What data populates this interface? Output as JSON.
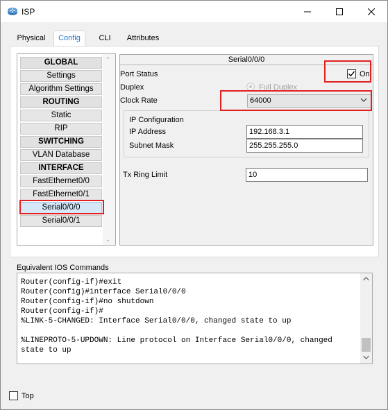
{
  "window": {
    "title": "ISP"
  },
  "tabs": [
    {
      "label": "Physical",
      "active": false
    },
    {
      "label": "Config",
      "active": true
    },
    {
      "label": "CLI",
      "active": false
    },
    {
      "label": "Attributes",
      "active": false
    }
  ],
  "sidebar": {
    "items": [
      {
        "label": "GLOBAL",
        "type": "header"
      },
      {
        "label": "Settings",
        "type": "item"
      },
      {
        "label": "Algorithm Settings",
        "type": "item"
      },
      {
        "label": "ROUTING",
        "type": "header"
      },
      {
        "label": "Static",
        "type": "item"
      },
      {
        "label": "RIP",
        "type": "item"
      },
      {
        "label": "SWITCHING",
        "type": "header"
      },
      {
        "label": "VLAN Database",
        "type": "item"
      },
      {
        "label": "INTERFACE",
        "type": "header"
      },
      {
        "label": "FastEthernet0/0",
        "type": "item"
      },
      {
        "label": "FastEthernet0/1",
        "type": "item"
      },
      {
        "label": "Serial0/0/0",
        "type": "item",
        "selected": true
      },
      {
        "label": "Serial0/0/1",
        "type": "item"
      }
    ]
  },
  "interface": {
    "title": "Serial0/0/0",
    "port_status_label": "Port Status",
    "port_status_checkbox_label": "On",
    "port_status_on": true,
    "duplex_label": "Duplex",
    "duplex_option": "Full Duplex",
    "clock_rate_label": "Clock Rate",
    "clock_rate_value": "64000",
    "ip_config_label": "IP Configuration",
    "ip_address_label": "IP Address",
    "ip_address_value": "192.168.3.1",
    "subnet_mask_label": "Subnet Mask",
    "subnet_mask_value": "255.255.255.0",
    "tx_ring_limit_label": "Tx Ring Limit",
    "tx_ring_limit_value": "10"
  },
  "ios": {
    "label": "Equivalent IOS Commands",
    "text": "Router(config-if)#exit\nRouter(config)#interface Serial0/0/0\nRouter(config-if)#no shutdown\nRouter(config-if)#\n%LINK-5-CHANGED: Interface Serial0/0/0, changed state to up\n\n%LINEPROTO-5-UPDOWN: Line protocol on Interface Serial0/0/0, changed\nstate to up"
  },
  "footer": {
    "top_label": "Top",
    "top_checked": false
  },
  "colors": {
    "highlight": "#e02020",
    "active_tab_text": "#1a7acc"
  }
}
